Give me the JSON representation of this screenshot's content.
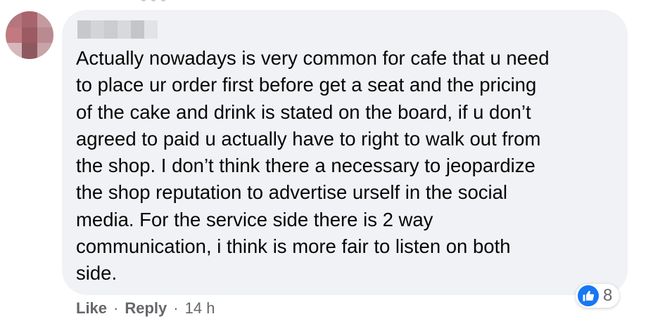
{
  "comment": {
    "text": "Actually nowadays is very common for cafe that u need\nto place ur order first before get a seat and the pricing\nof the cake and drink is stated on the board, if u don’t\nagreed to paid u actually have to right to walk out from\nthe shop. I don’t think there a necessary to jeopardize\nthe shop reputation to advertise urself in the social\nmedia. For the service side there is 2 way\ncommunication, i think is more fair to listen on both\nside."
  },
  "reactions": {
    "icon": "like-icon",
    "count": "8",
    "accent": "#1877f2"
  },
  "actions": {
    "like_label": "Like",
    "reply_label": "Reply",
    "separator": "·",
    "timestamp": "14 h"
  },
  "colors": {
    "bubble_bg": "#f0f2f5",
    "text": "#050505",
    "secondary_text": "#65676b"
  }
}
